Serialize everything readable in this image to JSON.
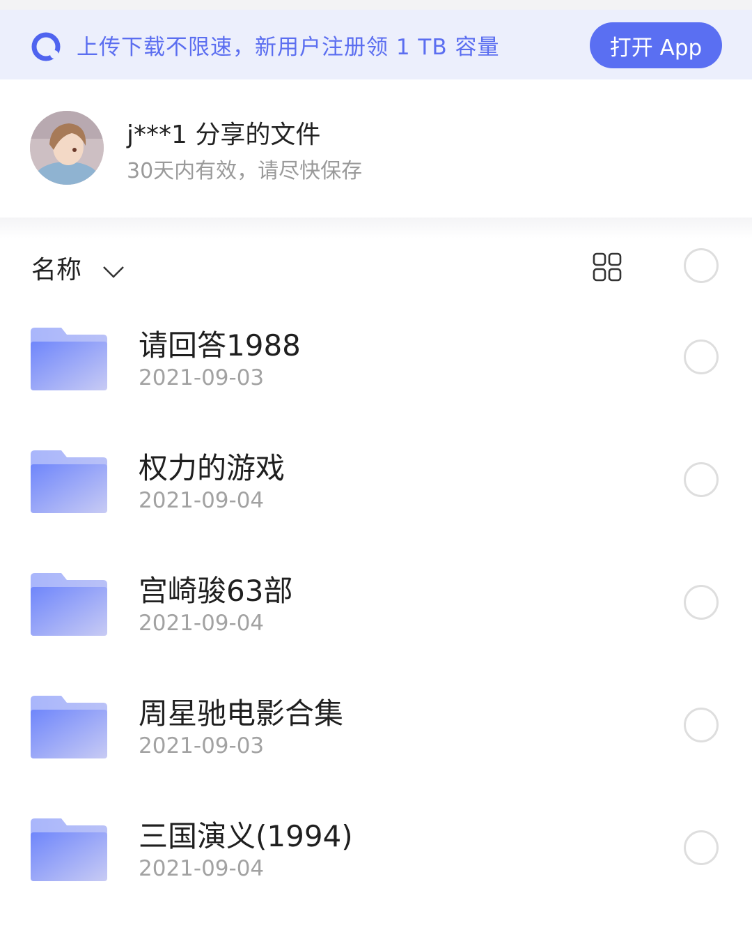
{
  "banner": {
    "text": "上传下载不限速，新用户注册领 1 TB 容量",
    "open_app_label": "打开 App",
    "accent": "#5a6ff2"
  },
  "share": {
    "title": "j***1 分享的文件",
    "subtitle": "30天内有效，请尽快保存"
  },
  "sort": {
    "label": "名称",
    "chevron_icon": "chevron-down-icon",
    "view_icon": "grid-view-icon"
  },
  "files": [
    {
      "name": "请回答1988",
      "date": "2021-09-03"
    },
    {
      "name": "权力的游戏",
      "date": "2021-09-04"
    },
    {
      "name": "宫崎骏63部",
      "date": "2021-09-04"
    },
    {
      "name": "周星驰电影合集",
      "date": "2021-09-03"
    },
    {
      "name": "三国演义(1994)",
      "date": "2021-09-04"
    }
  ]
}
